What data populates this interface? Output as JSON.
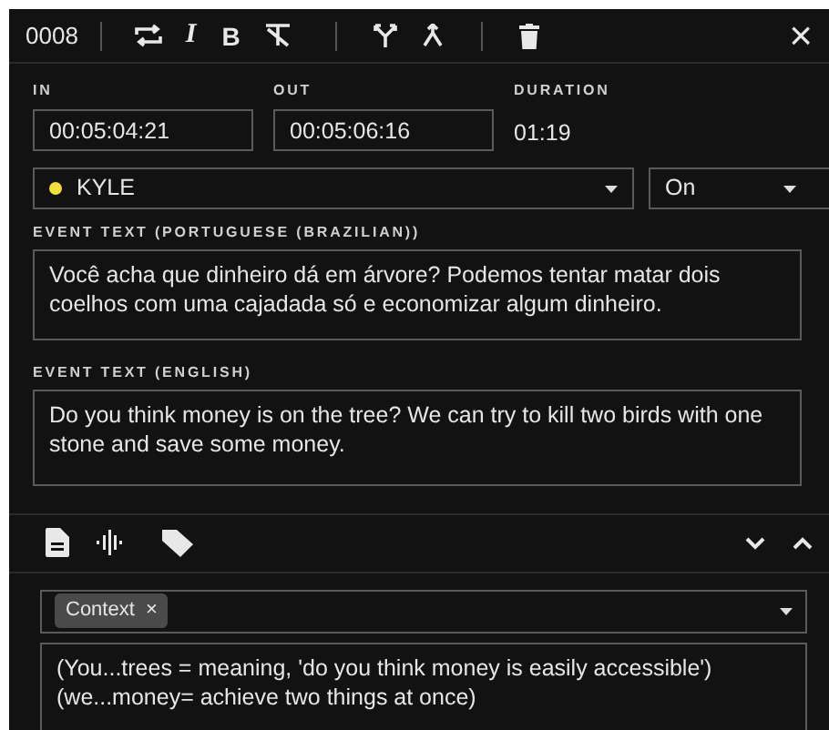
{
  "toolbar": {
    "event_number": "0008",
    "format_buttons": [
      {
        "kind": "italic",
        "label": "I"
      },
      {
        "kind": "bold",
        "label": "B"
      }
    ],
    "close": "×"
  },
  "timing": [
    {
      "kind": "field",
      "label": "IN",
      "value": "00:05:04:21"
    },
    {
      "kind": "field",
      "label": "OUT",
      "value": "00:05:06:16"
    },
    {
      "kind": "text",
      "label": "DURATION",
      "value": "01:19"
    }
  ],
  "speaker": {
    "name": "KYLE",
    "color": "#f2e03a"
  },
  "status_select": {
    "value": "On"
  },
  "event_texts": [
    {
      "label": "EVENT TEXT (PORTUGUESE (BRAZILIAN))",
      "value": "Você acha que dinheiro dá em árvore? Podemos tentar matar dois coelhos com uma cajadada só e economizar algum dinheiro."
    },
    {
      "label": "EVENT TEXT (ENGLISH)",
      "value": "Do you think money is on the tree? We can try to kill two birds with one stone and save some money."
    }
  ],
  "tags": [
    {
      "label": "Context",
      "remove": "×"
    }
  ],
  "note": {
    "value": "(You...trees = meaning, 'do you think money is easily accessible')\n(we...money= achieve two things at once)"
  }
}
